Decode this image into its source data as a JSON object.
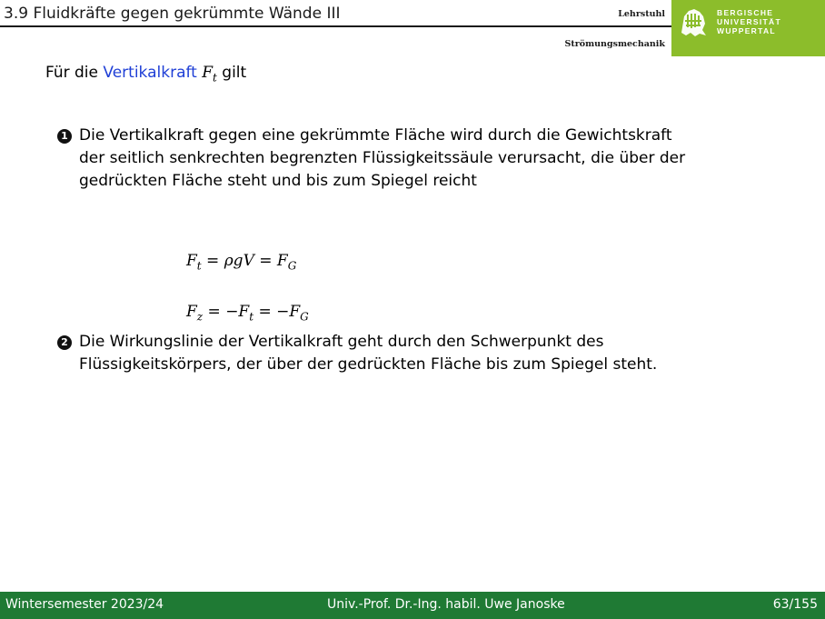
{
  "header": {
    "title": "3.9 Fluidkräfte gegen gekrümmte Wände III",
    "chair_line1": "Lehrstuhl",
    "chair_line2": "Strömungsmechanik",
    "logo": {
      "line1": "BERGISCHE",
      "line2": "UNIVERSITÄT",
      "line3": "WUPPERTAL",
      "icon": "university-lion-emblem-icon",
      "color": "#8cbd2b"
    }
  },
  "body": {
    "intro_prefix": "Für die",
    "intro_term": "Vertikalkraft",
    "intro_var": "F",
    "intro_var_sub": "t",
    "intro_suffix": "gilt",
    "accent_color": "#1f3fd6",
    "items": [
      {
        "badge": "1",
        "text": "Die Vertikalkraft gegen eine gekrümmte Fläche wird durch die Gewichtskraft der seitlich senkrechten begrenzten Flüssigkeitssäule verursacht, die über der gedrückten Fläche steht und bis zum Spiegel reicht"
      },
      {
        "badge": "2",
        "text": "Die Wirkungslinie der Vertikalkraft geht durch den Schwerpunkt des Flüssigkeitskörpers, der über der gedrückten Fläche bis zum Spiegel steht."
      }
    ],
    "equations": {
      "eq1": {
        "lhs": "F",
        "lhs_sub": "t",
        "mid": "ρgV",
        "rhs": "F",
        "rhs_sub": "G"
      },
      "eq2": {
        "lhs": "F",
        "lhs_sub": "z",
        "mid": "−F",
        "mid_sub": "t",
        "rhs": "−F",
        "rhs_sub": "G"
      }
    }
  },
  "footer": {
    "semester": "Wintersemester 2023/24",
    "author": "Univ.-Prof. Dr.-Ing. habil. Uwe Janoske",
    "page": "63/155",
    "color": "#1f7a34"
  }
}
